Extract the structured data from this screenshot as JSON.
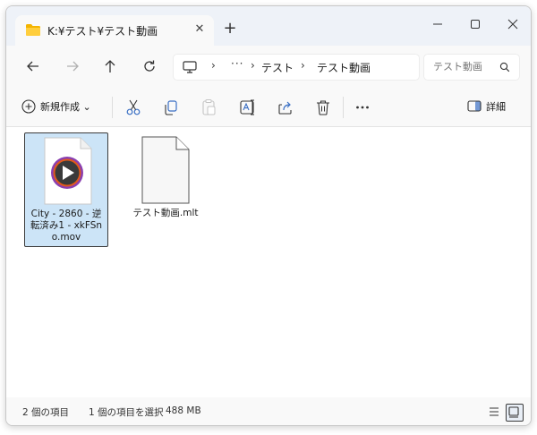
{
  "window": {
    "tab_title": "K:¥テスト¥テスト動画",
    "tab_close": "✕",
    "new_tab": "+"
  },
  "address": {
    "dots": "···",
    "crumbs": [
      "テスト",
      "テスト動画"
    ],
    "separator": "›"
  },
  "search": {
    "placeholder": "テスト動画"
  },
  "commandbar": {
    "new_label": "新規作成 ⌄",
    "details_label": "詳細",
    "icons": [
      "cut-icon",
      "copy-icon",
      "paste-icon",
      "rename-icon",
      "share-icon",
      "delete-icon",
      "more-icon"
    ]
  },
  "files": [
    {
      "name": "City - 2860 - 逆転済み1 - xkFSno.mov",
      "type": "video",
      "selected": true
    },
    {
      "name": "テスト動画.mlt",
      "type": "document",
      "selected": false
    }
  ],
  "status": {
    "item_count": "2 個の項目",
    "selection": "1 個の項目を選択",
    "size": "488 MB"
  },
  "colors": {
    "accent": "#0067c0",
    "selection": "#cce4f7"
  }
}
